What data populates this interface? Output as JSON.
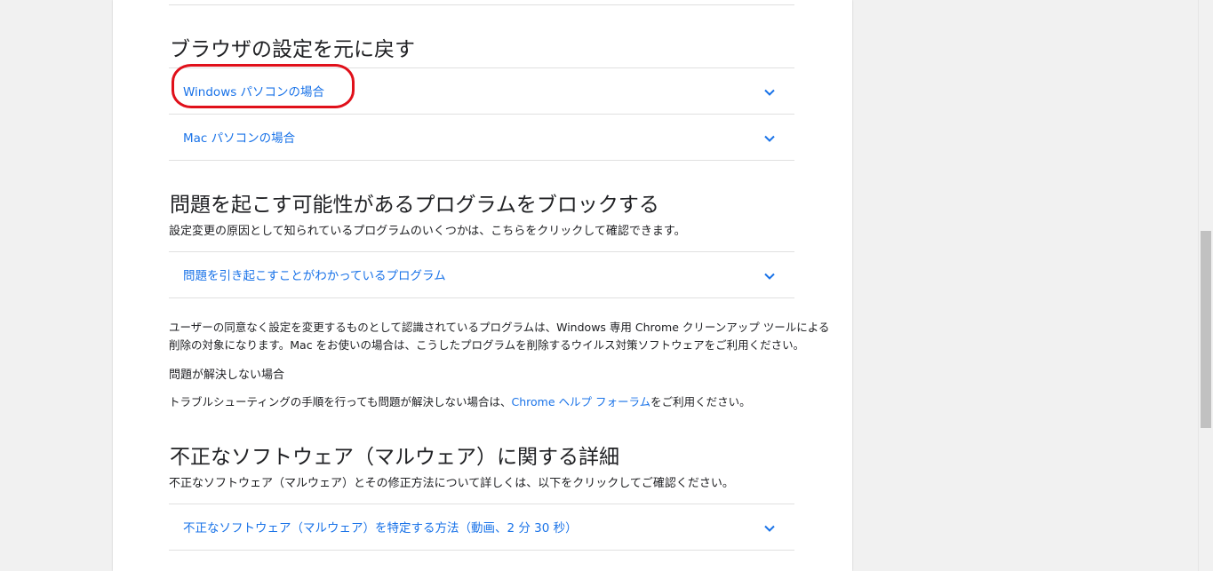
{
  "sections": {
    "reset": {
      "heading": "ブラウザの設定を元に戻す",
      "items": [
        {
          "label": "Windows パソコンの場合"
        },
        {
          "label": "Mac パソコンの場合"
        }
      ]
    },
    "block": {
      "heading": "問題を起こす可能性があるプログラムをブロックする",
      "intro": "設定変更の原因として知られているプログラムのいくつかは、こちらをクリックして確認できます。",
      "items": [
        {
          "label": "問題を引き起こすことがわかっているプログラム"
        }
      ],
      "note_line1": "ユーザーの同意なく設定を変更するものとして認識されているプログラムは、Windows 専用 Chrome クリーンアップ ツールによる",
      "note_line2": "削除の対象になります。Mac をお使いの場合は、こうしたプログラムを削除するウイルス対策ソフトウェアをご利用ください。",
      "unresolved_title": "問題が解決しない場合",
      "unresolved_before": "トラブルシューティングの手順を行っても問題が解決しない場合は、",
      "unresolved_link": "Chrome ヘルプ フォーラム",
      "unresolved_after": "をご利用ください。"
    },
    "malware": {
      "heading": "不正なソフトウェア（マルウェア）に関する詳細",
      "intro": "不正なソフトウェア（マルウェア）とその修正方法について詳しくは、以下をクリックしてご確認ください。",
      "items": [
        {
          "label": "不正なソフトウェア（マルウェア）を特定する方法（動画、2 分 30 秒）"
        }
      ]
    }
  },
  "icons": {
    "expand": "chevron-down-icon"
  },
  "colors": {
    "link": "#1a73e8",
    "highlight": "#e0101a",
    "divider": "#e0e0e0"
  }
}
